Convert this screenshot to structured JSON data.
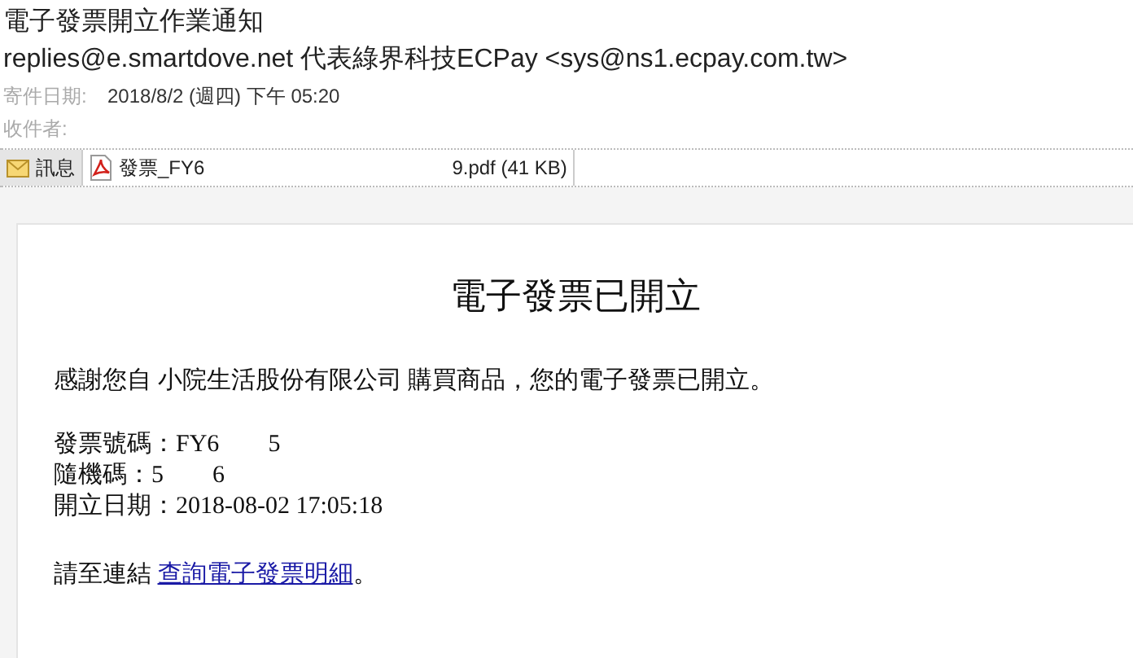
{
  "subject": "電子發票開立作業通知",
  "sender": "replies@e.smartdove.net 代表綠界科技ECPay <sys@ns1.ecpay.com.tw>",
  "fields": [
    {
      "label": "寄件日期:",
      "value": "2018/8/2 (週四) 下午 05:20"
    },
    {
      "label": "收件者:"
    }
  ],
  "tabs": [
    {
      "kind": "message",
      "label": "訊息",
      "selected": true
    },
    {
      "kind": "pdf",
      "label": "發票_FY6",
      "tail": "9.pdf (41 KB)",
      "selected": false
    }
  ],
  "body": {
    "heading": "電子發票已開立",
    "intro": "感謝您自 小院生活股份有限公司 購買商品，您的電子發票已開立。",
    "details": [
      {
        "label": "發票號碼：",
        "parts": [
          "FY6",
          "5"
        ]
      },
      {
        "label": "隨機碼：",
        "parts": [
          "5",
          "6"
        ]
      },
      {
        "label": "開立日期：",
        "parts": [
          "2018-08-02 17:05:18"
        ]
      }
    ],
    "link_prefix": "請至連結 ",
    "link": "查詢電子發票明細",
    "link_suffix": "。"
  }
}
